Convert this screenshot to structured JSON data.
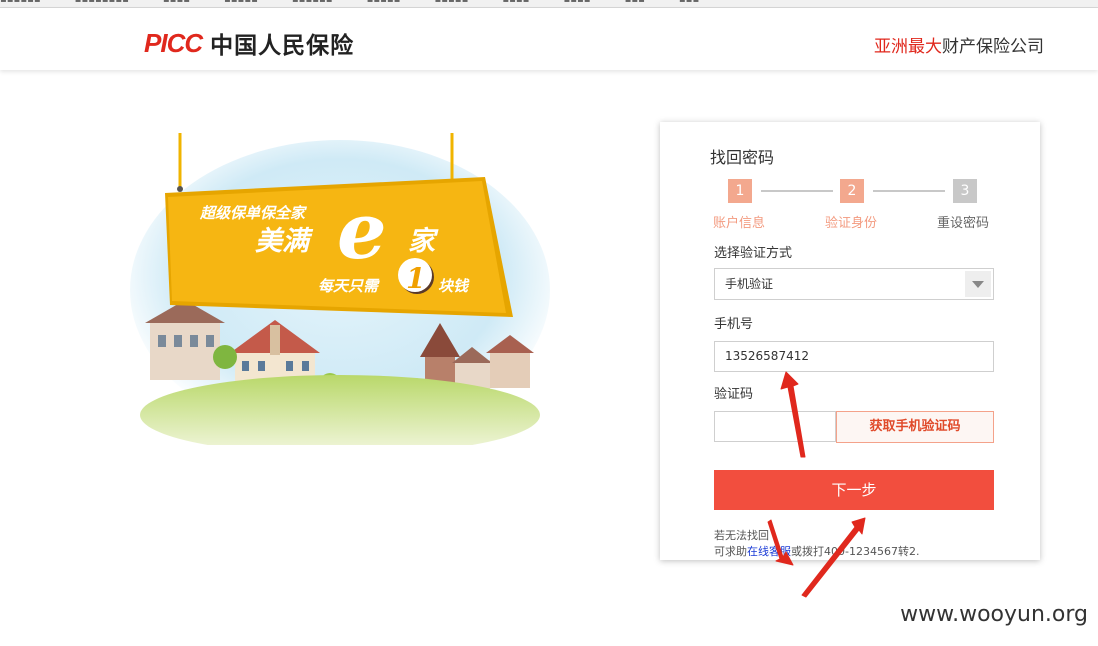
{
  "header": {
    "logo_latin": "PICC",
    "logo_cn": "中国人民保险",
    "slogan_highlight": "亚洲最大",
    "slogan_rest": "财产保险公司"
  },
  "banner": {
    "line1": "超级保单保全家",
    "line2a": "美满",
    "line2_letter": "e",
    "line2b": "家",
    "line3a": "每天只需",
    "line3_number": "1",
    "line3b": "块钱"
  },
  "form": {
    "title": "找回密码",
    "steps": [
      {
        "number": "1",
        "label": "账户信息",
        "state": "active"
      },
      {
        "number": "2",
        "label": "验证身份",
        "state": "active"
      },
      {
        "number": "3",
        "label": "重设密码",
        "state": "inactive"
      }
    ],
    "method_label": "选择验证方式",
    "method_value": "手机验证",
    "phone_label": "手机号",
    "phone_value": "13526587412",
    "code_label": "验证码",
    "code_value": "",
    "sms_button": "获取手机验证码",
    "next_button": "下一步",
    "help_line1": "若无法找回",
    "help_line2_prefix": "可求助",
    "help_link": "在线客服",
    "help_line2_suffix": "或拨打400-1234567转2."
  },
  "watermark": "www.wooyun.org",
  "colors": {
    "brand_red": "#e0281d",
    "step_active": "#f3a88e",
    "step_inactive": "#c8c8c8",
    "primary_button": "#f24e3e",
    "banner_yellow": "#f6b612"
  }
}
